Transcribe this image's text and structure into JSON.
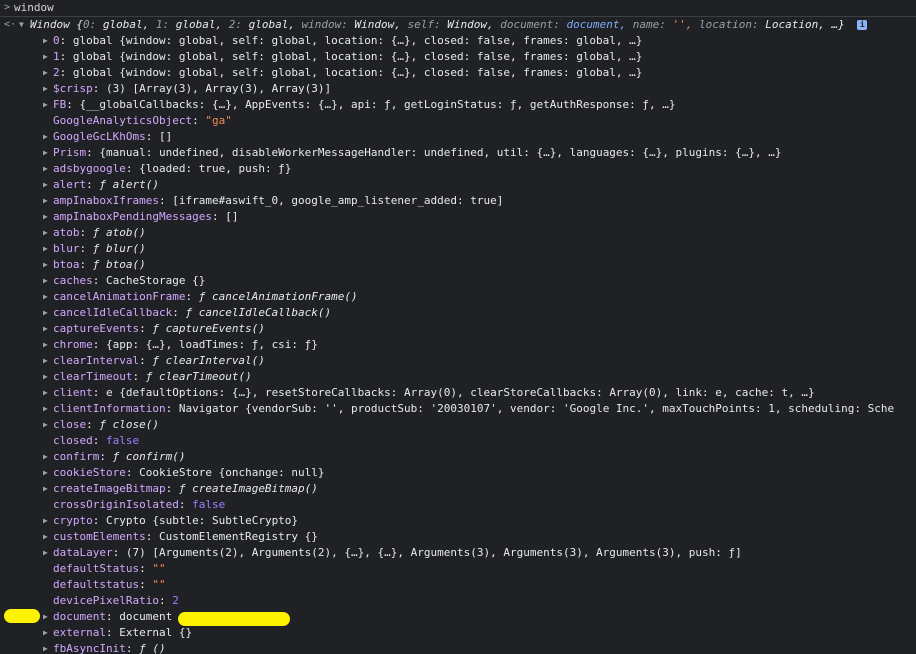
{
  "console": {
    "input": "window",
    "result_summary_prefix": "Window {",
    "result_summary_parts": [
      {
        "k": "0",
        "v": "global"
      },
      {
        "k": "1",
        "v": "global"
      },
      {
        "k": "2",
        "v": "global"
      },
      {
        "k": "window",
        "v": "Window"
      },
      {
        "k": "self",
        "v": "Window"
      },
      {
        "k": "document",
        "v": "document"
      },
      {
        "k": "name",
        "v": "''"
      },
      {
        "k": "location",
        "v": "Location"
      }
    ],
    "result_summary_suffix": "…}",
    "info_badge": "i",
    "rows": [
      {
        "key": "0",
        "expandable": true,
        "text": "global {window: global, self: global, location: {…}, closed: false, frames: global, …}"
      },
      {
        "key": "1",
        "expandable": true,
        "text": "global {window: global, self: global, location: {…}, closed: false, frames: global, …}"
      },
      {
        "key": "2",
        "expandable": true,
        "text": "global {window: global, self: global, location: {…}, closed: false, frames: global, …}"
      },
      {
        "key": "$crisp",
        "expandable": true,
        "text": "(3) [Array(3), Array(3), Array(3)]"
      },
      {
        "key": "FB",
        "expandable": true,
        "text": "{__globalCallbacks: {…}, AppEvents: {…}, api: ƒ, getLoginStatus: ƒ, getAuthResponse: ƒ, …}"
      },
      {
        "key": "GoogleAnalyticsObject",
        "expandable": false,
        "text": "\"ga\""
      },
      {
        "key": "GoogleGcLKhOms",
        "expandable": true,
        "text": "[]"
      },
      {
        "key": "Prism",
        "expandable": true,
        "text": "{manual: undefined, disableWorkerMessageHandler: undefined, util: {…}, languages: {…}, plugins: {…}, …}"
      },
      {
        "key": "adsbygoogle",
        "expandable": true,
        "text": "{loaded: true, push: ƒ}"
      },
      {
        "key": "alert",
        "expandable": true,
        "text": "ƒ alert()"
      },
      {
        "key": "ampInaboxIframes",
        "expandable": true,
        "text": "[iframe#aswift_0, google_amp_listener_added: true]"
      },
      {
        "key": "ampInaboxPendingMessages",
        "expandable": true,
        "text": "[]"
      },
      {
        "key": "atob",
        "expandable": true,
        "text": "ƒ atob()"
      },
      {
        "key": "blur",
        "expandable": true,
        "text": "ƒ blur()"
      },
      {
        "key": "btoa",
        "expandable": true,
        "text": "ƒ btoa()"
      },
      {
        "key": "caches",
        "expandable": true,
        "text": "CacheStorage {}"
      },
      {
        "key": "cancelAnimationFrame",
        "expandable": true,
        "text": "ƒ cancelAnimationFrame()"
      },
      {
        "key": "cancelIdleCallback",
        "expandable": true,
        "text": "ƒ cancelIdleCallback()"
      },
      {
        "key": "captureEvents",
        "expandable": true,
        "text": "ƒ captureEvents()"
      },
      {
        "key": "chrome",
        "expandable": true,
        "text": "{app: {…}, loadTimes: ƒ, csi: ƒ}"
      },
      {
        "key": "clearInterval",
        "expandable": true,
        "text": "ƒ clearInterval()"
      },
      {
        "key": "clearTimeout",
        "expandable": true,
        "text": "ƒ clearTimeout()"
      },
      {
        "key": "client",
        "expandable": true,
        "text": "e {defaultOptions: {…}, resetStoreCallbacks: Array(0), clearStoreCallbacks: Array(0), link: e, cache: t, …}"
      },
      {
        "key": "clientInformation",
        "expandable": true,
        "text": "Navigator {vendorSub: '', productSub: '20030107', vendor: 'Google Inc.', maxTouchPoints: 1, scheduling: Sche"
      },
      {
        "key": "close",
        "expandable": true,
        "text": "ƒ close()"
      },
      {
        "key": "closed",
        "expandable": false,
        "text": "false"
      },
      {
        "key": "confirm",
        "expandable": true,
        "text": "ƒ confirm()"
      },
      {
        "key": "cookieStore",
        "expandable": true,
        "text": "CookieStore {onchange: null}"
      },
      {
        "key": "createImageBitmap",
        "expandable": true,
        "text": "ƒ createImageBitmap()"
      },
      {
        "key": "crossOriginIsolated",
        "expandable": false,
        "text": "false"
      },
      {
        "key": "crypto",
        "expandable": true,
        "text": "Crypto {subtle: SubtleCrypto}"
      },
      {
        "key": "customElements",
        "expandable": true,
        "text": "CustomElementRegistry {}"
      },
      {
        "key": "dataLayer",
        "expandable": true,
        "text": "(7) [Arguments(2), Arguments(2), {…}, {…}, Arguments(3), Arguments(3), Arguments(3), push: ƒ]"
      },
      {
        "key": "defaultStatus",
        "expandable": false,
        "text": "\"\""
      },
      {
        "key": "defaultstatus",
        "expandable": false,
        "text": "\"\""
      },
      {
        "key": "devicePixelRatio",
        "expandable": false,
        "text": "2"
      },
      {
        "key": "document",
        "expandable": true,
        "text": "document"
      },
      {
        "key": "external",
        "expandable": true,
        "text": "External {}"
      },
      {
        "key": "fbAsyncInit",
        "expandable": true,
        "text": "ƒ ()"
      }
    ]
  }
}
